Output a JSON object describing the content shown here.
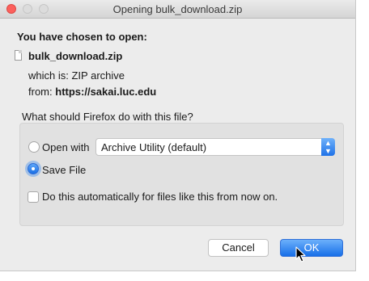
{
  "window": {
    "title": "Opening bulk_download.zip"
  },
  "dialog": {
    "heading": "You have chosen to open:",
    "file_name": "bulk_download.zip",
    "which_is_label": "which is:",
    "which_is_value": "ZIP archive",
    "from_label": "from:",
    "from_value": "https://sakai.luc.edu",
    "question": "What should Firefox do with this file?"
  },
  "options": {
    "open_with_label": "Open with",
    "open_with_selected": "Archive Utility (default)",
    "save_file_label": "Save File",
    "selected": "Save File",
    "auto_label": "Do this automatically for files like this from now on.",
    "auto_checked": false
  },
  "buttons": {
    "cancel": "Cancel",
    "ok": "OK"
  },
  "icons": {
    "file": "file-icon",
    "select_arrow": "chevron-updown-icon",
    "cursor": "pointer-cursor-icon"
  },
  "colors": {
    "accent": "#1f72e8",
    "close_button": "#fc605c"
  }
}
